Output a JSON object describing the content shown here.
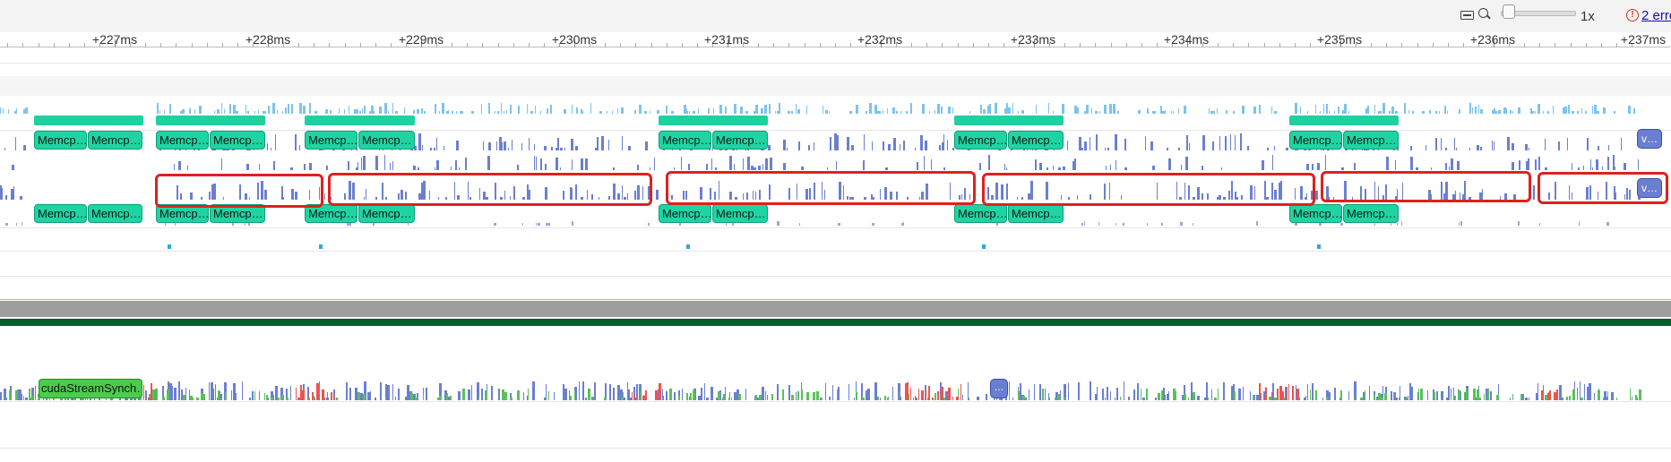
{
  "toolbar": {
    "keyboard_icon": "keyboard-icon",
    "zoom_icon": "zoom-icon",
    "zoom_value": "1x",
    "errors_link": "2 erro",
    "error_color": "#d32f2f"
  },
  "ruler": {
    "ticks": [
      "+227ms",
      "+228ms",
      "+229ms",
      "+230ms",
      "+231ms",
      "+232ms",
      "+233ms",
      "+234ms",
      "+235ms",
      "+236ms",
      "+237ms"
    ]
  },
  "tracks": {
    "memcpy_label": "Memcp…",
    "memcpy_color": "#1fd4a3",
    "kernel_color": "#6b7fd1",
    "v_chip_label": "v…",
    "sync_label": "cudaStreamSynch…",
    "ellipsis_label": "…",
    "highlight_color": "#e02020"
  }
}
